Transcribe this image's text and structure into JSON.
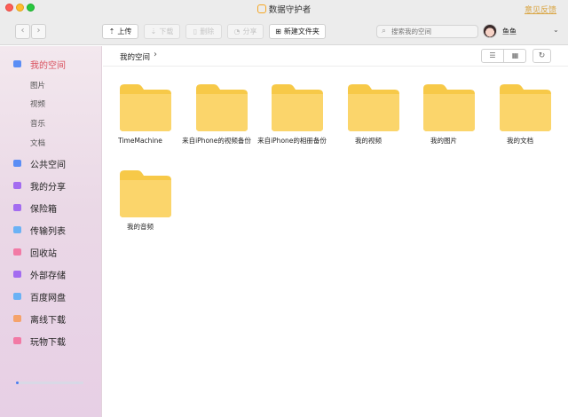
{
  "window": {
    "title": "数据守护者",
    "feedback_link": "意见反馈"
  },
  "toolbar": {
    "back_icon": "chevron-left-icon",
    "forward_icon": "chevron-right-icon",
    "upload_label": "上传",
    "download_label": "下载",
    "delete_label": "删除",
    "share_label": "分享",
    "new_folder_label": "新建文件夹",
    "search_placeholder": "搜索我的空间"
  },
  "user": {
    "name": "鱼鱼"
  },
  "sidebar": {
    "items": [
      {
        "label": "我的空间",
        "active": true,
        "icon": "folder-icon",
        "color": "#5b8ef5"
      },
      {
        "label": "公共空间",
        "icon": "public-icon",
        "color": "#5b8ef5"
      },
      {
        "label": "我的分享",
        "icon": "share-icon",
        "color": "#a36cf0"
      },
      {
        "label": "保险箱",
        "icon": "safe-icon",
        "color": "#a36cf0"
      },
      {
        "label": "传输列表",
        "icon": "transfer-icon",
        "color": "#6bb2f5"
      },
      {
        "label": "回收站",
        "icon": "trash-icon",
        "color": "#f27aa5"
      },
      {
        "label": "外部存储",
        "icon": "usb-icon",
        "color": "#a36cf0"
      },
      {
        "label": "百度网盘",
        "icon": "cloud-icon",
        "color": "#6bb2f5"
      },
      {
        "label": "离线下载",
        "icon": "offline-icon",
        "color": "#f5a36b"
      },
      {
        "label": "玩物下载",
        "icon": "wanwu-icon",
        "color": "#f27aa5"
      }
    ],
    "sub_items": [
      "图片",
      "视频",
      "音乐",
      "文档"
    ],
    "progress_fraction": 0.04
  },
  "main": {
    "breadcrumb": "我的空间",
    "folders": [
      {
        "name": "TimeMachine"
      },
      {
        "name": "来自iPhone的视频备份"
      },
      {
        "name": "来自iPhone的相册备份"
      },
      {
        "name": "我的视频"
      },
      {
        "name": "我的图片"
      },
      {
        "name": "我的文档"
      },
      {
        "name": "我的音频"
      }
    ]
  },
  "colors": {
    "accent": "#d94f5c",
    "folder": "#fbd56b",
    "folder_tab": "#f7c948"
  }
}
